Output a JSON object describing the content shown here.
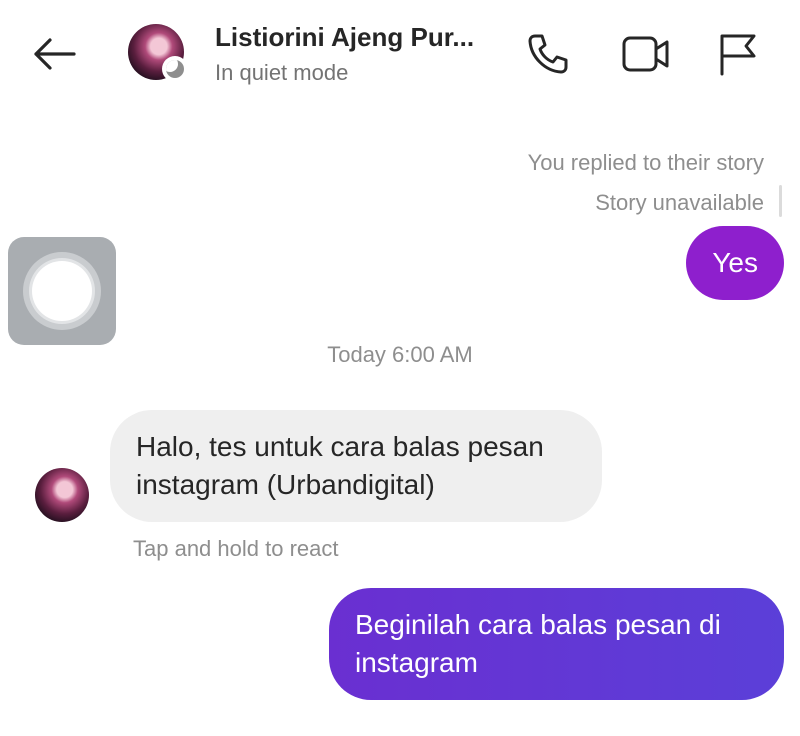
{
  "header": {
    "contact_name": "Listiorini Ajeng Pur...",
    "status": "In quiet mode",
    "icons": [
      "back-arrow-icon",
      "phone-icon",
      "video-camera-icon",
      "flag-icon"
    ]
  },
  "story": {
    "replied_label": "You replied to their story",
    "unavailable_label": "Story unavailable"
  },
  "messages": [
    {
      "direction": "outgoing",
      "text": "Yes"
    },
    {
      "direction": "incoming",
      "text": "Halo, tes untuk cara balas pesan instagram (Urbandigital)"
    },
    {
      "direction": "outgoing",
      "text": "Beginilah cara balas pesan di instagram"
    }
  ],
  "timestamp": "Today 6:00 AM",
  "react_hint": "Tap and hold to react",
  "colors": {
    "outgoing_purple": "#8e1fcd",
    "outgoing_violet": "#6a2fd1",
    "incoming_bubble": "#efefef",
    "muted_text": "#8e8e8e"
  }
}
